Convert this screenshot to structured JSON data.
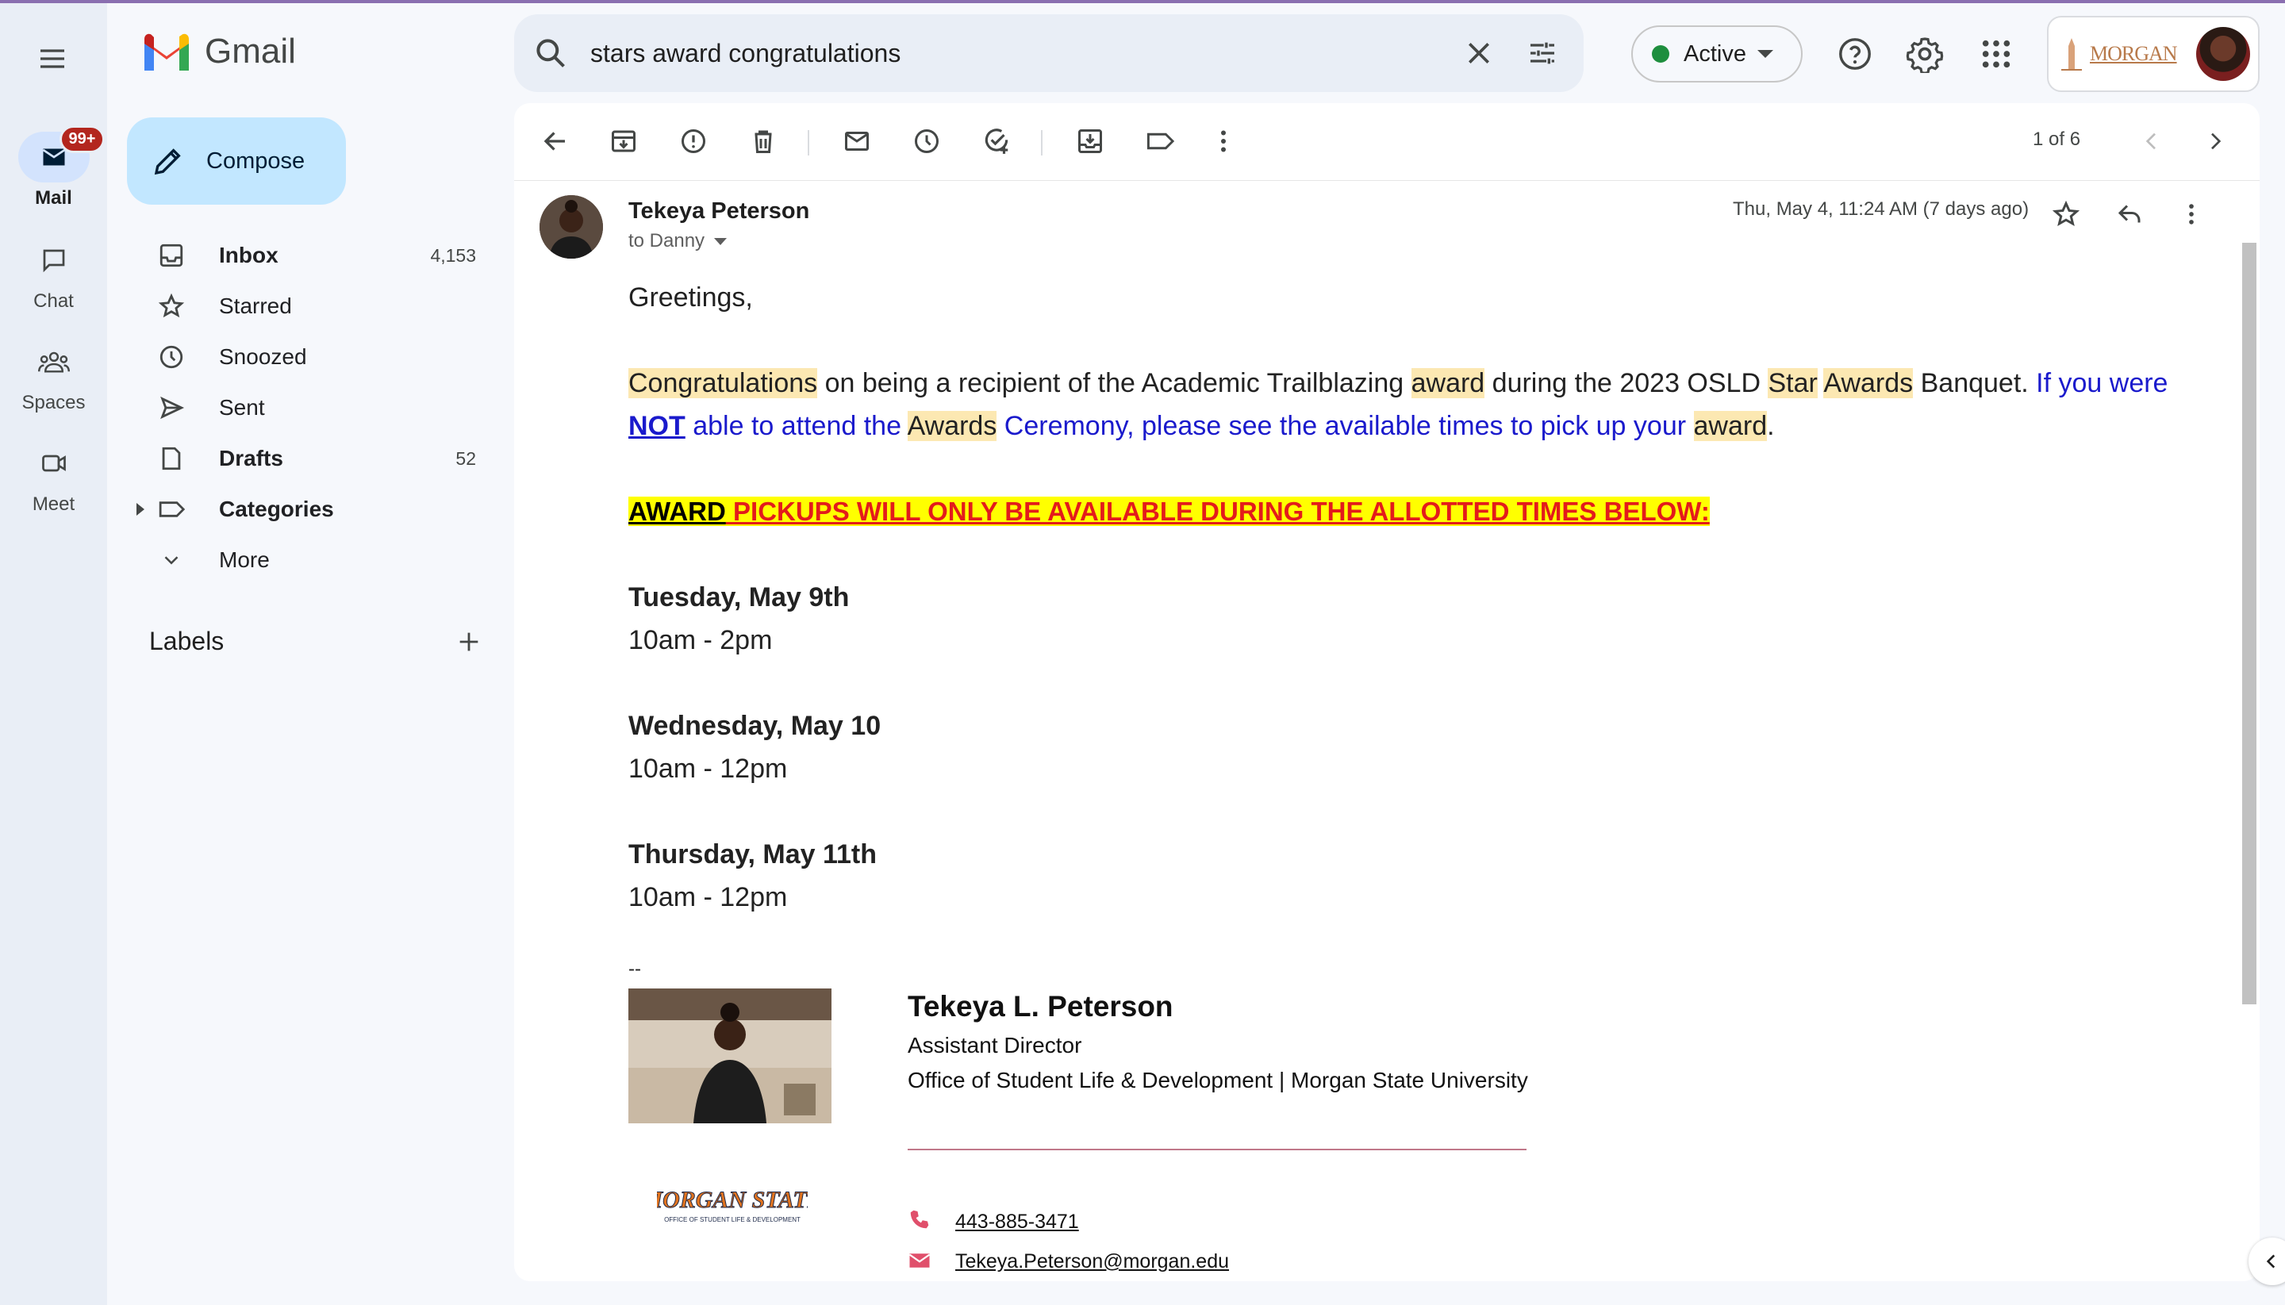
{
  "app": {
    "name": "Gmail",
    "colors": {
      "accent": "#c2e7ff",
      "badge": "#b3261e",
      "active_dot": "#1e8e3e",
      "highlight": "#fce8b2"
    }
  },
  "rail": {
    "items": [
      {
        "label": "Mail",
        "icon": "mail-icon",
        "badge": "99+",
        "active": true
      },
      {
        "label": "Chat",
        "icon": "chat-icon"
      },
      {
        "label": "Spaces",
        "icon": "spaces-icon"
      },
      {
        "label": "Meet",
        "icon": "meet-icon"
      }
    ]
  },
  "compose": {
    "label": "Compose"
  },
  "nav": {
    "items": [
      {
        "label": "Inbox",
        "count": "4,153",
        "icon": "inbox-icon"
      },
      {
        "label": "Starred",
        "count": "",
        "icon": "star-icon"
      },
      {
        "label": "Snoozed",
        "count": "",
        "icon": "clock-icon"
      },
      {
        "label": "Sent",
        "count": "",
        "icon": "send-icon"
      },
      {
        "label": "Drafts",
        "count": "52",
        "icon": "draft-icon"
      },
      {
        "label": "Categories",
        "count": "",
        "icon": "label-icon"
      },
      {
        "label": "More",
        "count": "",
        "icon": "chevron-down-icon"
      }
    ]
  },
  "labels": {
    "title": "Labels"
  },
  "search": {
    "value": "stars award congratulations"
  },
  "status": {
    "label": "Active"
  },
  "account": {
    "org_logo_text": "MORGAN"
  },
  "toolbar": {
    "pager": "1 of 6"
  },
  "message": {
    "sender": "Tekeya Peterson",
    "to": "to Danny",
    "date": "Thu, May 4, 11:24 AM (7 days ago)",
    "greeting": "Greetings,",
    "p1": {
      "w1": "Congratulations",
      "t1": " on being a recipient of the Academic Trailblazing ",
      "w2": "award",
      "t2": " during the 2023 OSLD ",
      "w3": "Star",
      "w4": "Awards",
      "t3": " Banquet. ",
      "b1": "If you were ",
      "b2": "NOT",
      "b3": " able to attend the ",
      "w5": "Awards",
      "b4": " Ceremony, please see the available times to pick up your ",
      "w6": "award",
      "t4": "."
    },
    "notice": {
      "black": "AWARD",
      "red": " PICKUPS  WILL ONLY BE AVAILABLE DURING THE ALLOTTED TIMES BELOW:"
    },
    "schedule": [
      {
        "day": "Tuesday, May 9th",
        "time": "10am - 2pm"
      },
      {
        "day": "Wednesday, May 10",
        "time": "10am - 12pm"
      },
      {
        "day": "Thursday, May 11th",
        "time": "10am - 12pm"
      }
    ],
    "signature": {
      "dash": "--",
      "name": "Tekeya L. Peterson",
      "title": "Assistant Director",
      "org": "Office of Student Life & Development | Morgan State University",
      "logo_text": "MORGAN STATE",
      "logo_sub": "OFFICE OF STUDENT LIFE & DEVELOPMENT",
      "phone": "443-885-3471",
      "email": "Tekeya.Peterson@morgan.edu"
    }
  }
}
